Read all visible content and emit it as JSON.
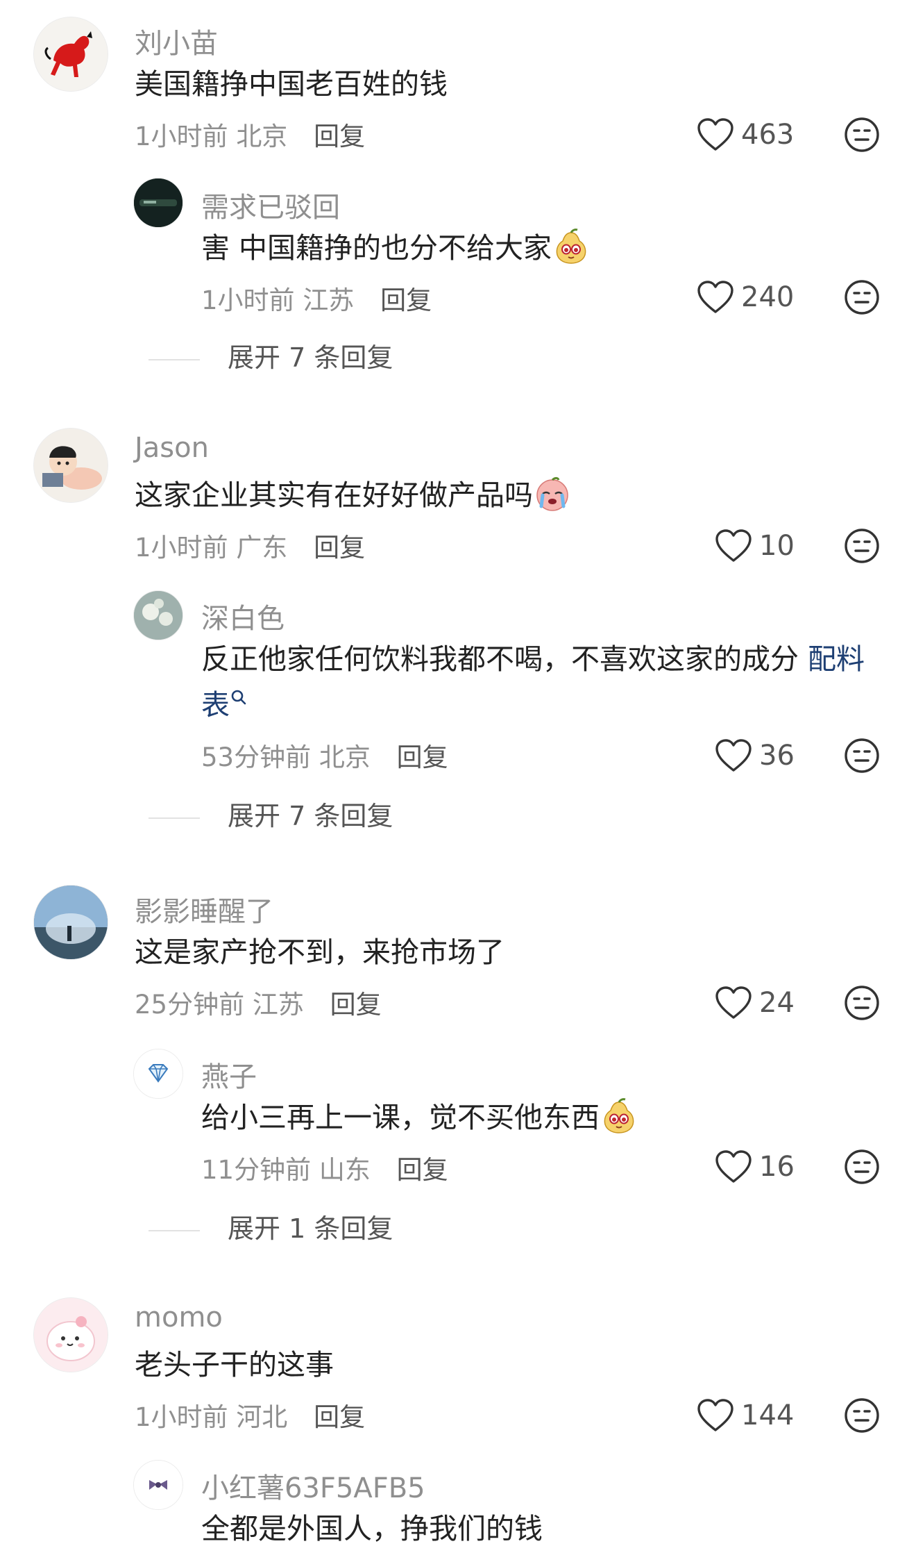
{
  "comments": [
    {
      "user": "刘小苗",
      "text": "美国籍挣中国老百姓的钱",
      "time": "1小时前",
      "location": "北京",
      "reply_label": "回复",
      "likes": "463",
      "replies": [
        {
          "user": "需求已驳回",
          "text": "害 中国籍挣的也分不给大家",
          "time": "1小时前",
          "location": "江苏",
          "reply_label": "回复",
          "likes": "240"
        }
      ],
      "expand_label": "展开 7 条回复"
    },
    {
      "user": "Jason",
      "text": "这家企业其实有在好好做产品吗",
      "time": "1小时前",
      "location": "广东",
      "reply_label": "回复",
      "likes": "10",
      "replies": [
        {
          "user": "深白色",
          "text_line1": "反正他家任何饮料我都不喝，不喜欢这家的成分",
          "link_part1": "配料",
          "link_part2": "表",
          "time": "53分钟前",
          "location": "北京",
          "reply_label": "回复",
          "likes": "36"
        }
      ],
      "expand_label": "展开 7 条回复"
    },
    {
      "user": "影影睡醒了",
      "text": "这是家产抢不到，来抢市场了",
      "time": "25分钟前",
      "location": "江苏",
      "reply_label": "回复",
      "likes": "24",
      "replies": [
        {
          "user": "燕子",
          "text": "给小三再上一课，觉不买他东西",
          "time": "11分钟前",
          "location": "山东",
          "reply_label": "回复",
          "likes": "16"
        }
      ],
      "expand_label": "展开 1 条回复"
    },
    {
      "user": "momo",
      "text": "老头子干的这事",
      "time": "1小时前",
      "location": "河北",
      "reply_label": "回复",
      "likes": "144",
      "replies": [
        {
          "user": "小红薯63F5AFB5",
          "text": "全都是外国人，挣我们的钱"
        }
      ]
    }
  ],
  "icons": {
    "like": "heart-outline-icon",
    "dislike": "neutral-face-icon",
    "search_link": "search-icon",
    "emoji_pear": "pear-face-emoji",
    "emoji_crying": "crying-face-emoji"
  }
}
